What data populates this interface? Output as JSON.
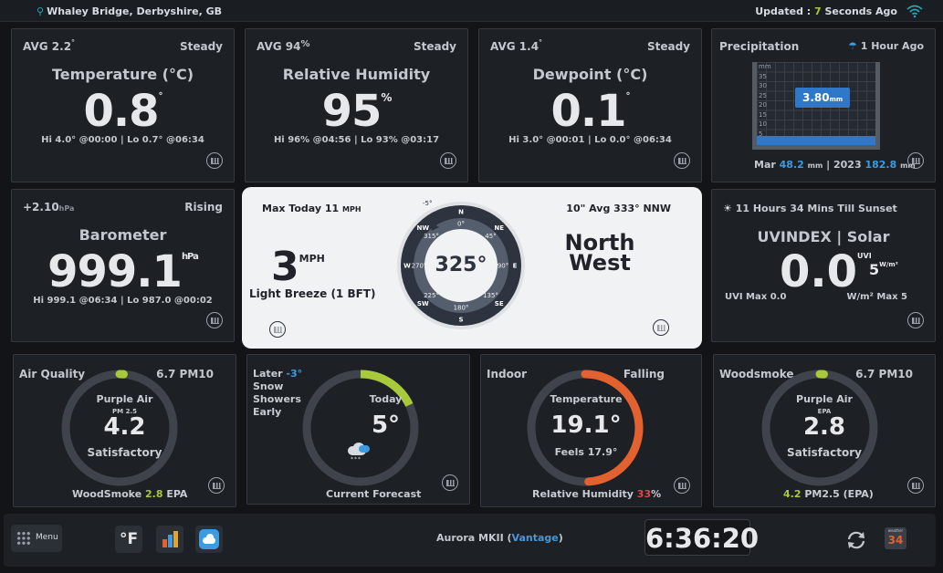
{
  "header": {
    "location": "Whaley Bridge, Derbyshire, GB",
    "updated_prefix": "Updated : ",
    "updated_num": "7",
    "updated_suffix": " Seconds Ago"
  },
  "temperature": {
    "avg": "AVG 2.2",
    "avg_unit": "°",
    "trend": "Steady",
    "title": "Temperature (°C)",
    "value": "0.8",
    "unit": "°",
    "hilo": "Hi 4.0° @00:00 | Lo 0.7° @06:34"
  },
  "humidity": {
    "avg": "AVG 94",
    "avg_unit": "%",
    "trend": "Steady",
    "title": "Relative Humidity",
    "value": "95",
    "unit": "%",
    "hilo": "Hi 96% @04:56 | Lo 93% @03:17"
  },
  "dewpoint": {
    "avg": "AVG 1.4",
    "avg_unit": "°",
    "trend": "Steady",
    "title": "Dewpoint (°C)",
    "value": "0.1",
    "unit": "°",
    "hilo": "Hi 3.0° @00:01 | Lo 0.0° @06:34"
  },
  "precip": {
    "title": "Precipitation",
    "ago": "1 Hour Ago",
    "value": "3.80",
    "unit": "mm",
    "scale": [
      "mm",
      "35",
      "30",
      "25",
      "20",
      "15",
      "10",
      "5"
    ],
    "mar_label": "Mar",
    "mar_value": "48.2",
    "mar_unit": "mm",
    "year_label": "| 2023",
    "year_value": "182.8",
    "year_unit": "mm",
    "fill_fraction": 0.11
  },
  "barometer": {
    "change": "+2.10",
    "change_unit": "hPa",
    "trend": "Rising",
    "title": "Barometer",
    "value": "999.1",
    "unit": "hPa",
    "hilo": "Hi 999.1 @06:34 | Lo 987.0 @00:02"
  },
  "wind": {
    "max": "Max Today 11",
    "max_unit": "MPH",
    "avg": "10\" Avg 333° NNW",
    "speed": "3",
    "speed_unit": "MPH",
    "desc": "Light Breeze (1 BFT)",
    "direction": "325°",
    "dir_word1": "North",
    "dir_word2": "West",
    "gust": "-5°",
    "compass": [
      "N",
      "NE",
      "E",
      "SE",
      "S",
      "SW",
      "W",
      "NW"
    ],
    "degrees": [
      "0°",
      "45°",
      "90°",
      "135°",
      "180°",
      "225°",
      "270°",
      "315°"
    ]
  },
  "uv": {
    "sunset": "11 Hours 34 Mins Till Sunset",
    "title": "UVINDEX | Solar",
    "value": "0.0",
    "uvi_label": "UVI",
    "solar": "5",
    "solar_unit": "W/m²",
    "uv_max": "UVI Max 0.0",
    "solar_max": "W/m² Max 5"
  },
  "airquality": {
    "title": "Air Quality",
    "pm": "6.7 PM10",
    "source": "Purple Air",
    "sub": "PM 2.5",
    "value": "4.2",
    "status": "Satisfactory",
    "footer_a": "WoodSmoke ",
    "footer_b": "2.8",
    "footer_c": " EPA",
    "level": 0.0
  },
  "forecast": {
    "later_a": "Later ",
    "later_b": "-3°",
    "later_text": "Snow Showers Early",
    "label": "Today",
    "value": "5°",
    "footer": "Current Forecast",
    "level": 0.18
  },
  "indoor": {
    "title": "Indoor",
    "trend": "Falling",
    "label": "Temperature",
    "value": "19.1°",
    "feels": "Feels 17.9°",
    "footer_a": "Relative Humidity ",
    "footer_b": "33",
    "footer_c": "%",
    "level": 0.49
  },
  "woodsmoke": {
    "title": "Woodsmoke",
    "pm": "6.7 PM10",
    "source": "Purple Air",
    "sub": "EPA",
    "value": "2.8",
    "status": "Satisfactory",
    "footer_a": "4.2",
    "footer_b": " PM2.5 (EPA)",
    "level": 0.0
  },
  "bottom": {
    "menu": "Menu",
    "unit_toggle": "°F",
    "station_a": "Aurora MKII (",
    "station_b": "Vantage",
    "station_c": ")",
    "clock": "6:36:20",
    "calendar_label": "weather",
    "calendar_day": "34"
  },
  "colors": {
    "accent_green": "#a8c93a",
    "accent_blue": "#3d9be0",
    "accent_orange": "#e2612e",
    "accent_red": "#e04848"
  }
}
